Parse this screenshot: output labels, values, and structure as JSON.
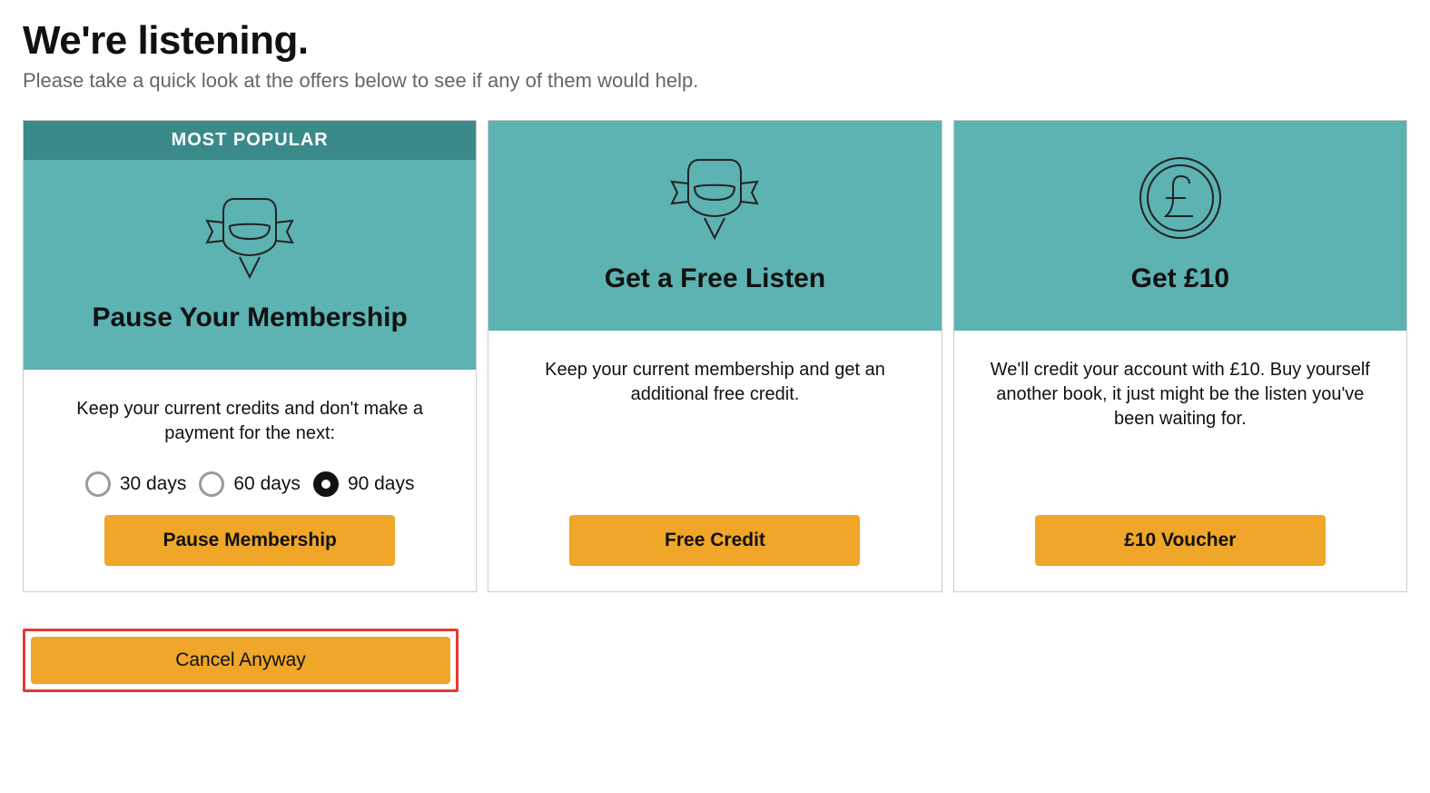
{
  "header": {
    "title": "We're listening.",
    "subtitle": "Please take a quick look at the offers below to see if any of them would help."
  },
  "cards": {
    "pause": {
      "badge": "MOST POPULAR",
      "title": "Pause Your Membership",
      "desc": "Keep your current credits and don't make a payment for the next:",
      "options": {
        "a": "30 days",
        "b": "60 days",
        "c": "90 days"
      },
      "selected": "c",
      "cta": "Pause Membership"
    },
    "free": {
      "title": "Get a Free Listen",
      "desc": "Keep your current membership and get an additional free credit.",
      "cta": "Free Credit"
    },
    "voucher": {
      "title": "Get £10",
      "desc": "We'll credit your account with £10. Buy yourself another book, it just might be the listen you've been waiting for.",
      "cta": "£10 Voucher"
    }
  },
  "cancel": {
    "label": "Cancel Anyway"
  }
}
